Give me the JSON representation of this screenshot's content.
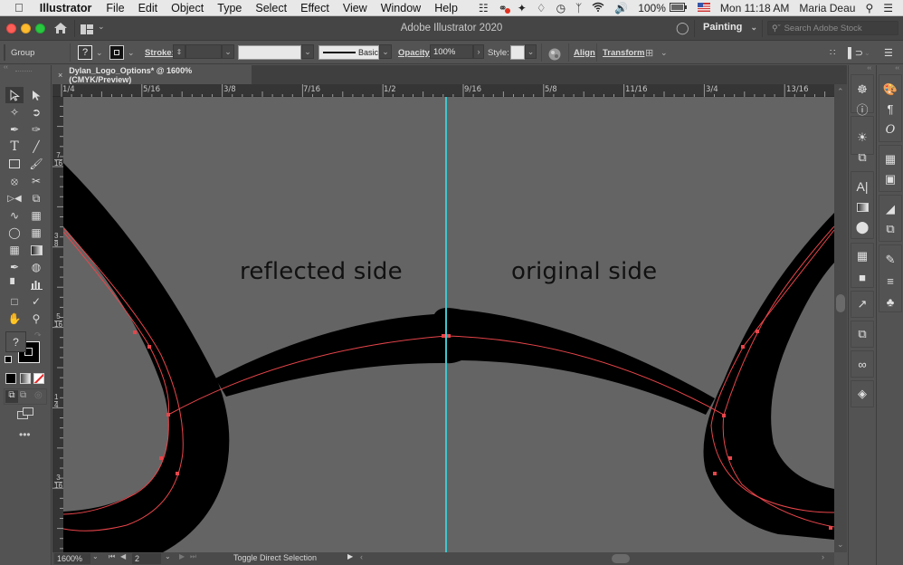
{
  "menubar": {
    "app_name": "Illustrator",
    "items": [
      "File",
      "Edit",
      "Object",
      "Type",
      "Select",
      "Effect",
      "View",
      "Window",
      "Help"
    ],
    "battery": "100%",
    "clock": "Mon 11:18 AM",
    "user": "Maria Deau"
  },
  "titlebar": {
    "title": "Adobe Illustrator 2020",
    "workspace": "Painting",
    "search_placeholder": "Search Adobe Stock"
  },
  "controlbar": {
    "selection_type": "Group",
    "fill_value": "?",
    "stroke_label": "Stroke:",
    "brush_label": "Basic",
    "opacity_label": "Opacity:",
    "opacity_value": "100%",
    "style_label": "Style:",
    "align_label": "Align",
    "transform_label": "Transform"
  },
  "document_tab": {
    "title": "Dylan_Logo_Options* @ 1600% (CMYK/Preview)"
  },
  "rulers": {
    "horizontal": [
      "1/4",
      "5/16",
      "3/8",
      "7/16",
      "1/2",
      "9/16",
      "5/8",
      "11/16",
      "3/4",
      "13/16"
    ],
    "vertical": [
      [
        "7",
        "16"
      ],
      [
        "3",
        "8"
      ],
      [
        "5",
        "16"
      ],
      [
        "1",
        "4"
      ],
      [
        "3",
        "16"
      ]
    ]
  },
  "canvas": {
    "label_left": "reflected side",
    "label_right": "original side",
    "guide_color": "#3fc6cf",
    "path_color": "#e8454a",
    "background": "#646464"
  },
  "statusbar": {
    "zoom": "1600%",
    "artboard": "2",
    "status_text": "Toggle Direct Selection"
  },
  "fill_swatch": "?"
}
